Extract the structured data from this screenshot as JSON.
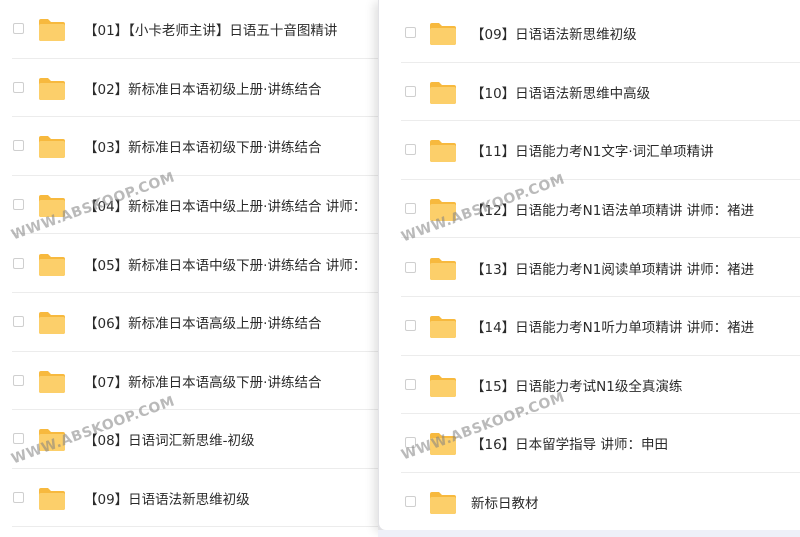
{
  "left_list": [
    {
      "label": "【01】【小卡老师主讲】日语五十音图精讲"
    },
    {
      "label": "【02】新标准日本语初级上册·讲练结合"
    },
    {
      "label": "【03】新标准日本语初级下册·讲练结合"
    },
    {
      "label": "【04】新标准日本语中级上册·讲练结合 讲师："
    },
    {
      "label": "【05】新标准日本语中级下册·讲练结合 讲师："
    },
    {
      "label": "【06】新标准日本语高级上册·讲练结合"
    },
    {
      "label": "【07】新标准日本语高级下册·讲练结合"
    },
    {
      "label": "【08】日语词汇新思维-初级"
    },
    {
      "label": "【09】日语语法新思维初级"
    }
  ],
  "right_list": [
    {
      "label": "【09】日语语法新思维初级"
    },
    {
      "label": "【10】日语语法新思维中高级"
    },
    {
      "label": "【11】日语能力考N1文字·词汇单项精讲"
    },
    {
      "label": "【12】日语能力考N1语法单项精讲 讲师：褚进"
    },
    {
      "label": "【13】日语能力考N1阅读单项精讲 讲师：褚进"
    },
    {
      "label": "【14】日语能力考N1听力单项精讲 讲师：褚进"
    },
    {
      "label": "【15】日语能力考试N1级全真演练"
    },
    {
      "label": "【16】日本留学指导 讲师：申田"
    },
    {
      "label": "新标日教材"
    }
  ],
  "watermark": "WWW.ABSKOOP.COM",
  "colors": {
    "folder": "#fccf6a",
    "folder_tab": "#f7b93e",
    "text": "#2b2b2b"
  },
  "icons": {
    "folder": "folder-icon"
  }
}
